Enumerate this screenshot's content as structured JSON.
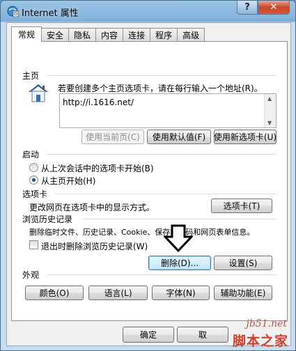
{
  "window": {
    "title": "Internet 属性",
    "help_label": "?",
    "close_label": "✕"
  },
  "tabs": [
    "常规",
    "安全",
    "隐私",
    "内容",
    "连接",
    "程序",
    "高级"
  ],
  "homepage": {
    "section_label": "主页",
    "description": "若要创建多个主页选项卡，请在每行输入一个地址(R)。",
    "value": "http://i.1616.net/",
    "btn_use_current": "使用当前页(C)",
    "btn_use_default": "使用默认值(F)",
    "btn_use_new_tab": "使用新选项卡(U)"
  },
  "startup": {
    "section_label": "启动",
    "option_last_session": "从上次会话中的选项卡开始(B)",
    "option_homepage": "从主页开始(H)"
  },
  "tab_section": {
    "section_label": "选项卡",
    "description": "更改网页在选项卡中的显示方式。",
    "btn_tabs": "选项卡(T)"
  },
  "history": {
    "section_label": "浏览历史记录",
    "description": "删除临时文件、历史记录、Cookie、保存的密码和网页表单信息。",
    "checkbox_label": "退出时删除浏览历史记录(W)",
    "btn_delete": "删除(D)...",
    "btn_settings": "设置(S)"
  },
  "appearance": {
    "section_label": "外观",
    "btn_colors": "颜色(O)",
    "btn_languages": "语言(L)",
    "btn_fonts": "字体(N)",
    "btn_accessibility": "辅助功能(E)"
  },
  "footer": {
    "btn_ok": "确定",
    "btn_cancel": "取"
  },
  "watermark": {
    "url": "jb51.net",
    "text": "脚本之家"
  }
}
